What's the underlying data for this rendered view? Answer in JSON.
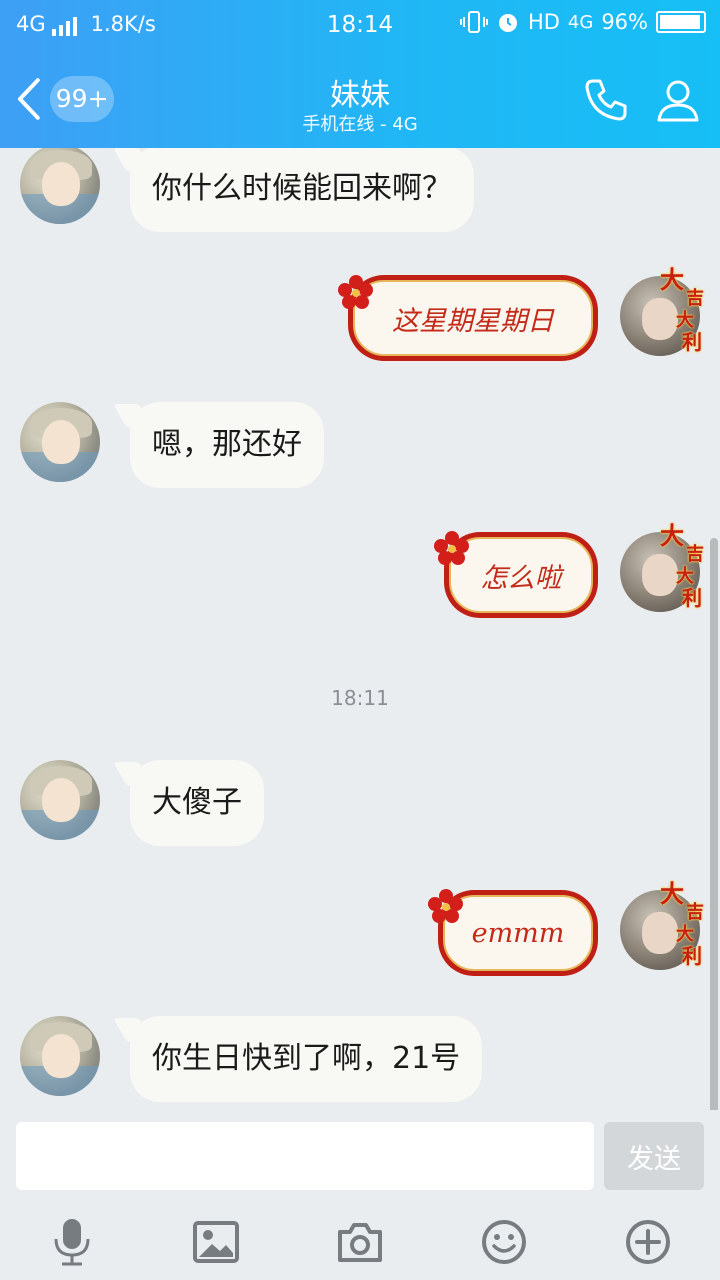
{
  "status_bar": {
    "network": "4G",
    "speed": "1.8K/s",
    "time": "18:14",
    "hd": "HD",
    "network_right": "4G",
    "battery_pct": "96%",
    "battery_level": 0.96
  },
  "header": {
    "back_badge": "99+",
    "title": "妹妹",
    "subtitle": "手机在线 - 4G"
  },
  "messages": [
    {
      "from": "them",
      "text": "你什么时候能回来啊？"
    },
    {
      "from": "me",
      "text": "这星期星期日"
    },
    {
      "from": "them",
      "text": "嗯，那还好"
    },
    {
      "from": "me",
      "text": "怎么啦"
    },
    {
      "from": "them",
      "text": "大傻子"
    },
    {
      "from": "me",
      "text": "emmm"
    },
    {
      "from": "them",
      "text": "你生日快到了啊，21号"
    }
  ],
  "timestamp": "18:11",
  "avatar_badge": [
    "大",
    "吉",
    "大",
    "利"
  ],
  "input": {
    "placeholder": "",
    "send_label": "发送"
  },
  "toolbar_icons": [
    "microphone-icon",
    "image-icon",
    "camera-icon",
    "emoji-icon",
    "plus-icon"
  ],
  "colors": {
    "header_start": "#3e9ff5",
    "header_end": "#16bff6",
    "chat_bg": "#e9edf0",
    "festive_red": "#c01f16"
  }
}
